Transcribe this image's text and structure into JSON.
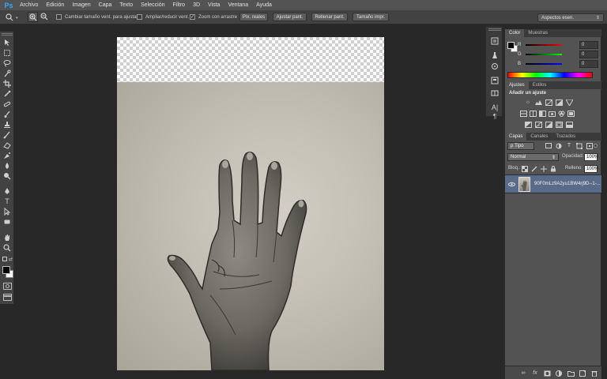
{
  "app": {
    "logo": "Ps"
  },
  "menu": [
    "Archivo",
    "Edición",
    "Imagen",
    "Capa",
    "Texto",
    "Selección",
    "Filtro",
    "3D",
    "Vista",
    "Ventana",
    "Ayuda"
  ],
  "options": {
    "resize_windows_label": "Cambiar tamaño vent. para ajustar",
    "resize_windows_checked": false,
    "zoom_all_label": "Ampliar/reducir vent.",
    "zoom_all_checked": false,
    "scrubby_zoom_label": "Zoom con arrastre",
    "scrubby_zoom_checked": true,
    "actual_pixels_label": "Píx. reales",
    "fit_screen_label": "Ajustar pant.",
    "fill_screen_label": "Rellenar pant.",
    "print_size_label": "Tamaño impr.",
    "workspace_label": "Aspectos esen."
  },
  "color_panel": {
    "tabs": [
      "Color",
      "Muestras"
    ],
    "active_tab": "Color",
    "channels": [
      {
        "label": "R",
        "value": "0",
        "color": "#d63030"
      },
      {
        "label": "G",
        "value": "0",
        "color": "#2fb52f"
      },
      {
        "label": "B",
        "value": "0",
        "color": "#3a3ad6"
      }
    ]
  },
  "adjustments_panel": {
    "tabs": [
      "Ajustes",
      "Estilos"
    ],
    "active_tab": "Ajustes",
    "title": "Añadir un ajuste"
  },
  "layers_panel": {
    "tabs": [
      "Capas",
      "Canales",
      "Trazados"
    ],
    "active_tab": "Capas",
    "filter_label": "ρ Tipo",
    "blend_mode": "Normal",
    "opacity_label": "Opacidad:",
    "opacity": "100%",
    "lock_label": "Bloq.:",
    "fill_label": "Relleno:",
    "fill": "100%",
    "layers": [
      {
        "name": "90F0mLz9A2yu1BW4rj9D--1-...",
        "selected": true,
        "visible": true
      }
    ]
  },
  "icons": {
    "tools": [
      "move-icon",
      "marquee-icon",
      "lasso-icon",
      "quick-select-icon",
      "crop-icon",
      "eyedropper-icon",
      "healing-icon",
      "brush-icon",
      "clone-stamp-icon",
      "history-brush-icon",
      "eraser-icon",
      "gradient-icon",
      "blur-icon",
      "dodge-icon",
      "pen-icon",
      "type-icon",
      "path-select-icon",
      "shape-icon",
      "hand-icon",
      "zoom-icon"
    ]
  }
}
